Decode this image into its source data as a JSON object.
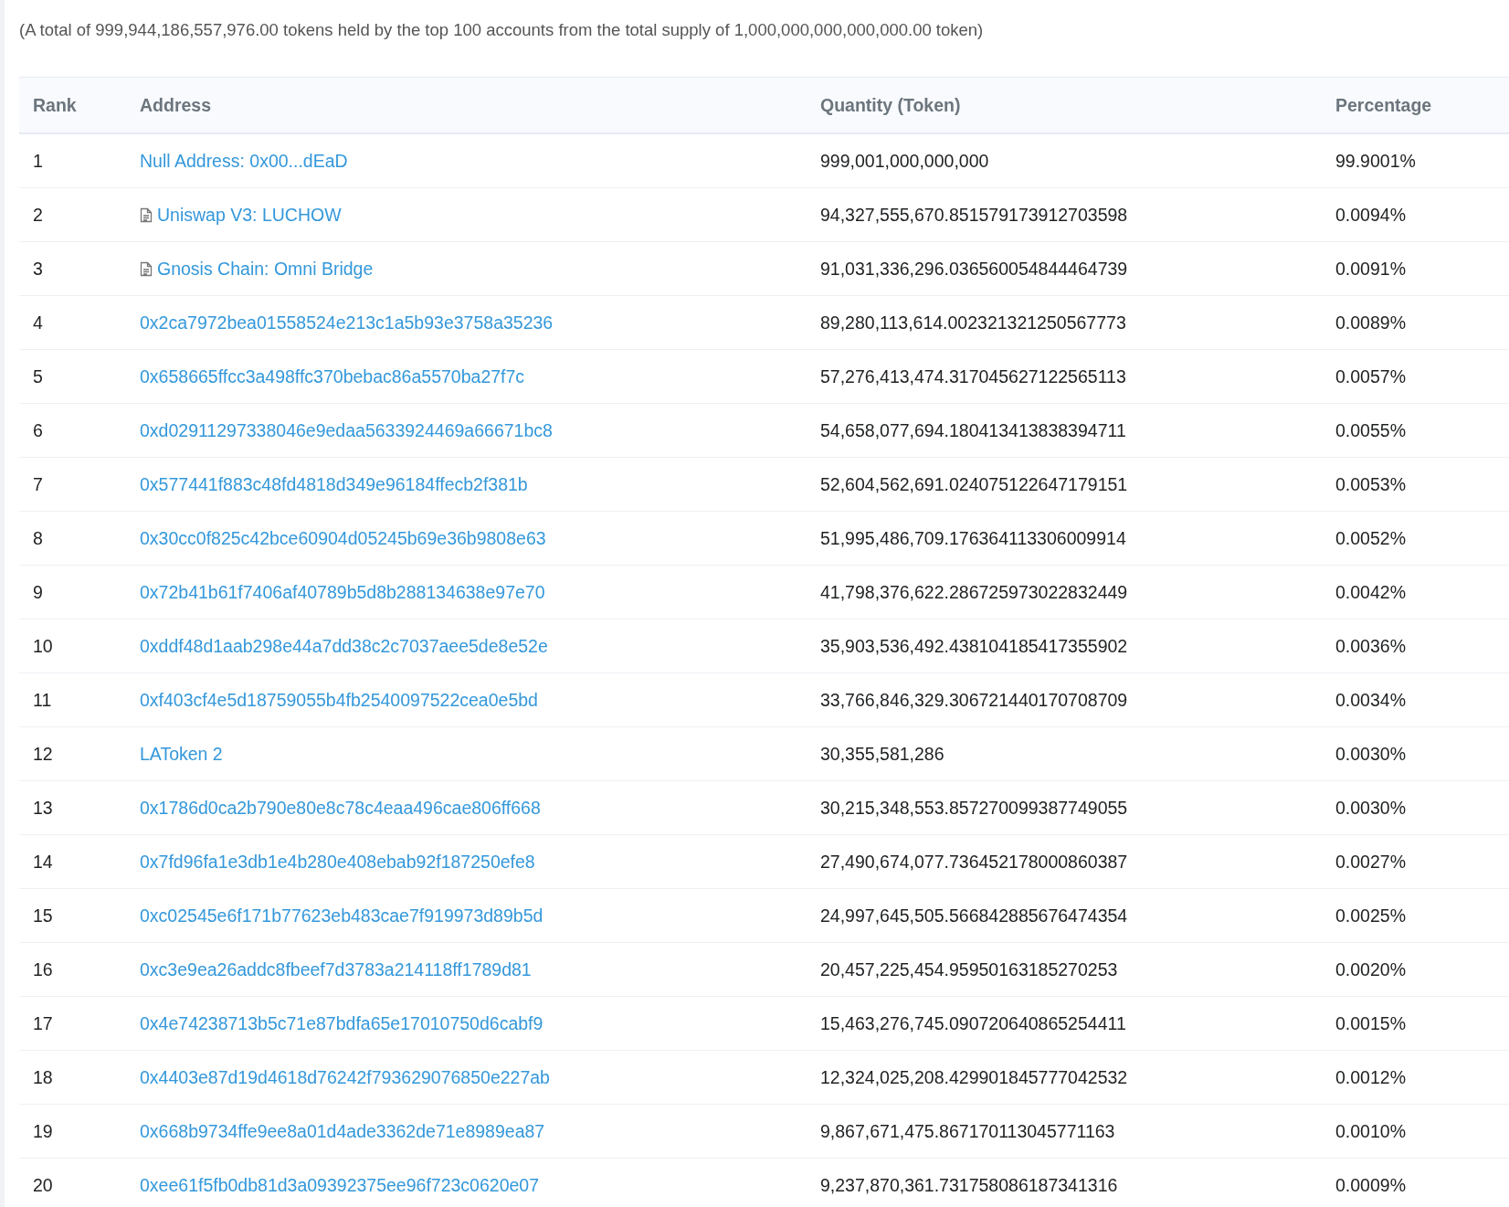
{
  "summary": "(A total of 999,944,186,557,976.00 tokens held by the top 100 accounts from the total supply of 1,000,000,000,000,000.00 token)",
  "table": {
    "columns": [
      "Rank",
      "Address",
      "Quantity (Token)",
      "Percentage"
    ],
    "rows": [
      {
        "rank": "1",
        "address": "Null Address: 0x00...dEaD",
        "contract": false,
        "quantity": "999,001,000,000,000",
        "percentage": "99.9001%"
      },
      {
        "rank": "2",
        "address": "Uniswap V3: LUCHOW",
        "contract": true,
        "quantity": "94,327,555,670.851579173912703598",
        "percentage": "0.0094%"
      },
      {
        "rank": "3",
        "address": "Gnosis Chain: Omni Bridge",
        "contract": true,
        "quantity": "91,031,336,296.036560054844464739",
        "percentage": "0.0091%"
      },
      {
        "rank": "4",
        "address": "0x2ca7972bea01558524e213c1a5b93e3758a35236",
        "contract": false,
        "quantity": "89,280,113,614.002321321250567773",
        "percentage": "0.0089%"
      },
      {
        "rank": "5",
        "address": "0x658665ffcc3a498ffc370bebac86a5570ba27f7c",
        "contract": false,
        "quantity": "57,276,413,474.317045627122565113",
        "percentage": "0.0057%"
      },
      {
        "rank": "6",
        "address": "0xd02911297338046e9edaa5633924469a66671bc8",
        "contract": false,
        "quantity": "54,658,077,694.180413413838394711",
        "percentage": "0.0055%"
      },
      {
        "rank": "7",
        "address": "0x577441f883c48fd4818d349e96184ffecb2f381b",
        "contract": false,
        "quantity": "52,604,562,691.024075122647179151",
        "percentage": "0.0053%"
      },
      {
        "rank": "8",
        "address": "0x30cc0f825c42bce60904d05245b69e36b9808e63",
        "contract": false,
        "quantity": "51,995,486,709.176364113306009914",
        "percentage": "0.0052%"
      },
      {
        "rank": "9",
        "address": "0x72b41b61f7406af40789b5d8b288134638e97e70",
        "contract": false,
        "quantity": "41,798,376,622.286725973022832449",
        "percentage": "0.0042%"
      },
      {
        "rank": "10",
        "address": "0xddf48d1aab298e44a7dd38c2c7037aee5de8e52e",
        "contract": false,
        "quantity": "35,903,536,492.438104185417355902",
        "percentage": "0.0036%"
      },
      {
        "rank": "11",
        "address": "0xf403cf4e5d18759055b4fb2540097522cea0e5bd",
        "contract": false,
        "quantity": "33,766,846,329.306721440170708709",
        "percentage": "0.0034%"
      },
      {
        "rank": "12",
        "address": "LAToken 2",
        "contract": false,
        "quantity": "30,355,581,286",
        "percentage": "0.0030%"
      },
      {
        "rank": "13",
        "address": "0x1786d0ca2b790e80e8c78c4eaa496cae806ff668",
        "contract": false,
        "quantity": "30,215,348,553.857270099387749055",
        "percentage": "0.0030%"
      },
      {
        "rank": "14",
        "address": "0x7fd96fa1e3db1e4b280e408ebab92f187250efe8",
        "contract": false,
        "quantity": "27,490,674,077.736452178000860387",
        "percentage": "0.0027%"
      },
      {
        "rank": "15",
        "address": "0xc02545e6f171b77623eb483cae7f919973d89b5d",
        "contract": false,
        "quantity": "24,997,645,505.566842885676474354",
        "percentage": "0.0025%"
      },
      {
        "rank": "16",
        "address": "0xc3e9ea26addc8fbeef7d3783a214118ff1789d81",
        "contract": false,
        "quantity": "20,457,225,454.95950163185270253",
        "percentage": "0.0020%"
      },
      {
        "rank": "17",
        "address": "0x4e74238713b5c71e87bdfa65e17010750d6cabf9",
        "contract": false,
        "quantity": "15,463,276,745.090720640865254411",
        "percentage": "0.0015%"
      },
      {
        "rank": "18",
        "address": "0x4403e87d19d4618d76242f793629076850e227ab",
        "contract": false,
        "quantity": "12,324,025,208.429901845777042532",
        "percentage": "0.0012%"
      },
      {
        "rank": "19",
        "address": "0x668b9734ffe9ee8a01d4ade3362de71e8989ea87",
        "contract": false,
        "quantity": "9,867,671,475.867170113045771163",
        "percentage": "0.0010%"
      },
      {
        "rank": "20",
        "address": "0xee61f5fb0db81d3a09392375ee96f723c0620e07",
        "contract": false,
        "quantity": "9,237,870,361.731758086187341316",
        "percentage": "0.0009%"
      }
    ]
  }
}
